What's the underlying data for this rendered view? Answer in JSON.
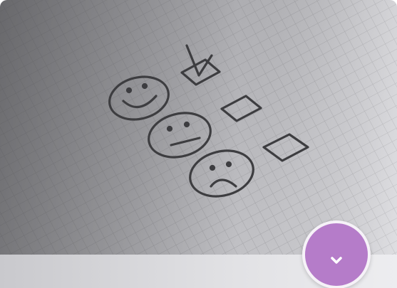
{
  "card": {
    "image_subject": "paper-feedback-checklist",
    "expand_icon": "chevron-down-icon",
    "accent_color": "#b57cc9"
  }
}
